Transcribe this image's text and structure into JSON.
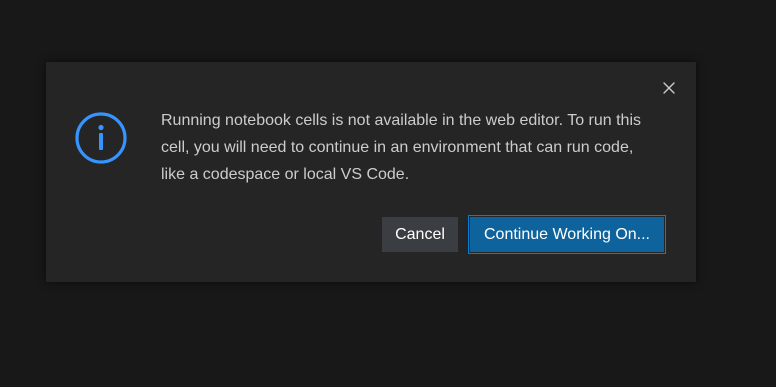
{
  "dialog": {
    "message": "Running notebook cells is not available in the web editor. To run this cell, you will need to continue in an environment that can run code, like a codespace or local VS Code.",
    "icon": "info-icon",
    "close_icon": "close-icon",
    "buttons": {
      "cancel_label": "Cancel",
      "primary_label": "Continue Working On..."
    }
  },
  "colors": {
    "background": "#181818",
    "dialog_background": "#252526",
    "accent": "#3794ff",
    "primary_button": "#0e639c",
    "secondary_button": "#3a3d41",
    "text": "#cccccc"
  }
}
